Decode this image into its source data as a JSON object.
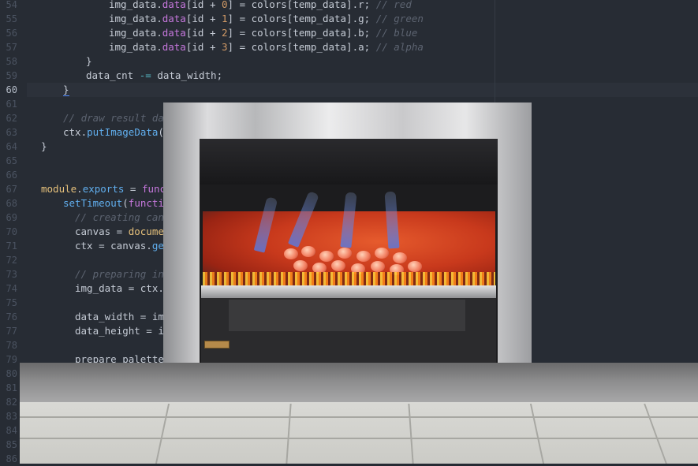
{
  "gutter": {
    "line_numbers": [
      "54",
      "55",
      "56",
      "57",
      "58",
      "59",
      "60",
      "61",
      "62",
      "63",
      "64",
      "65",
      "66",
      "67",
      "68",
      "69",
      "70",
      "71",
      "72",
      "73",
      "74",
      "75",
      "76",
      "77",
      "78",
      "79",
      "80",
      "81",
      "82",
      "83",
      "84",
      "85",
      "86"
    ],
    "active_line": "60"
  },
  "code": {
    "l54": {
      "t1": "img_data.",
      "t2": "data",
      "t3": "[id + ",
      "t4": "0",
      "t5": "] = colors[temp_data].r; ",
      "t6": "// red"
    },
    "l55": {
      "t1": "img_data.",
      "t2": "data",
      "t3": "[id + ",
      "t4": "1",
      "t5": "] = colors[temp_data].g; ",
      "t6": "// green"
    },
    "l56": {
      "t1": "img_data.",
      "t2": "data",
      "t3": "[id + ",
      "t4": "2",
      "t5": "] = colors[temp_data].b; ",
      "t6": "// blue"
    },
    "l57": {
      "t1": "img_data.",
      "t2": "data",
      "t3": "[id + ",
      "t4": "3",
      "t5": "] = colors[temp_data].a; ",
      "t6": "// alpha"
    },
    "l58": "}",
    "l59": {
      "t1": "data_cnt ",
      "t2": "-=",
      "t3": " data_width;"
    },
    "l60": "}",
    "l62": "// draw result da",
    "l63": {
      "t1": "ctx.",
      "t2": "putImageData",
      "t3": "(i"
    },
    "l64": "}",
    "l67": {
      "t1": "module",
      "t2": ".",
      "t3": "exports",
      "t4": " = ",
      "t5": "funct"
    },
    "l68": {
      "t1": "setTimeout",
      "t2": "(",
      "t3": "functio"
    },
    "l69": "// creating canv",
    "l70": {
      "t1": "canvas = ",
      "t2": "documen"
    },
    "l71": {
      "t1": "ctx = canvas.",
      "t2": "get"
    },
    "l73": "// preparing in",
    "l74": {
      "t1": "img_data = ctx.",
      "t2": "c"
    },
    "l76": {
      "t1": "data_width = img"
    },
    "l77": {
      "t1": "data_height = im"
    },
    "l79": {
      "t1": "prepare_palette("
    }
  },
  "colors": {
    "background": "#272c34",
    "active_line": "#2c313a",
    "keyword": "#c678dd",
    "function": "#61afef",
    "number": "#d19a66",
    "comment": "#5c6370"
  }
}
